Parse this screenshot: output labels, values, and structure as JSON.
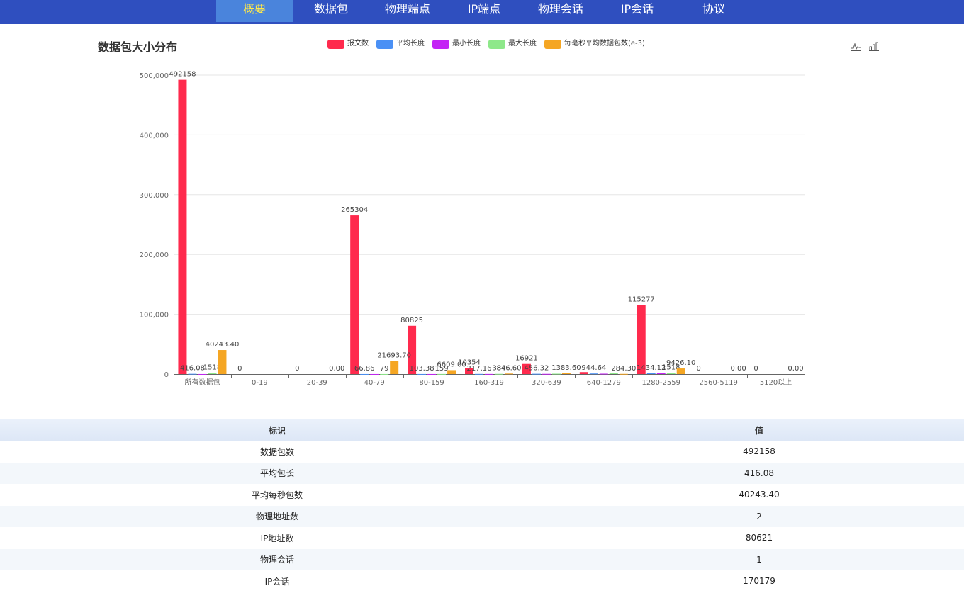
{
  "nav": {
    "items": [
      {
        "label": "概要",
        "active": true
      },
      {
        "label": "数据包"
      },
      {
        "label": "物理端点"
      },
      {
        "label": "IP端点"
      },
      {
        "label": "物理会话"
      },
      {
        "label": "IP会话"
      },
      {
        "label": "协议"
      }
    ]
  },
  "chart": {
    "title": "数据包大小分布",
    "tool_icons": [
      "line-chart-icon",
      "bar-chart-icon"
    ]
  },
  "chart_data": {
    "type": "bar",
    "title": "数据包大小分布",
    "categories": [
      "所有数据包",
      "0-19",
      "20-39",
      "40-79",
      "80-159",
      "160-319",
      "320-639",
      "640-1279",
      "1280-2559",
      "2560-5119",
      "5120以上"
    ],
    "ylim": [
      0,
      500000
    ],
    "yticks": [
      "0",
      "100,000",
      "200,000",
      "300,000",
      "400,000",
      "500,000"
    ],
    "grid": true,
    "legend_position": "top-center",
    "series": [
      {
        "name": "报文数",
        "color": "#ff2a4d",
        "values": [
          492158,
          0,
          0,
          265304,
          80825,
          10354,
          16921,
          3277,
          115277,
          0,
          0
        ],
        "labels": [
          "492158",
          "0",
          "0",
          "265304",
          "80825",
          "10354",
          "16921",
          "",
          "115277",
          "0",
          "0"
        ]
      },
      {
        "name": "平均长度",
        "color": "#4a90f5",
        "values": [
          416.08,
          null,
          null,
          66.86,
          103.38,
          217.16,
          456.32,
          944.64,
          1434.12,
          null,
          null
        ],
        "labels": [
          "416.08",
          "",
          "",
          "66.86",
          "103.38",
          "217.16",
          "456.32",
          "944.64",
          "1434.12",
          "",
          ""
        ]
      },
      {
        "name": "最小长度",
        "color": "#c424f5",
        "values": [
          60,
          null,
          null,
          60,
          80,
          160,
          320,
          640,
          1280,
          null,
          null
        ],
        "labels": [
          "",
          "",
          "",
          "",
          "",
          "",
          "",
          "",
          "",
          "",
          ""
        ]
      },
      {
        "name": "最大长度",
        "color": "#8ee88a",
        "values": [
          1518,
          null,
          null,
          79,
          159,
          319,
          639,
          1279,
          1518,
          null,
          null
        ],
        "labels": [
          "1518",
          "",
          "",
          "79",
          "159",
          "384",
          "",
          "",
          "1518",
          "",
          ""
        ]
      },
      {
        "name": "每毫秒平均数据包数(e-3)",
        "color": "#f5a623",
        "values": [
          40243.4,
          0,
          0,
          21693.7,
          6609.0,
          846.6,
          1383.6,
          284.3,
          9426.1,
          0,
          0
        ],
        "labels": [
          "40243.40",
          "",
          "0.00",
          "21693.70",
          "6609.00",
          "846.60",
          "1383.60",
          "284.30",
          "9426.10",
          "0.00",
          "0.00"
        ]
      }
    ]
  },
  "table": {
    "headers": [
      "标识",
      "值"
    ],
    "rows": [
      [
        "数据包数",
        "492158"
      ],
      [
        "平均包长",
        "416.08"
      ],
      [
        "平均每秒包数",
        "40243.40"
      ],
      [
        "物理地址数",
        "2"
      ],
      [
        "IP地址数",
        "80621"
      ],
      [
        "物理会话",
        "1"
      ],
      [
        "IP会话",
        "170179"
      ]
    ]
  }
}
